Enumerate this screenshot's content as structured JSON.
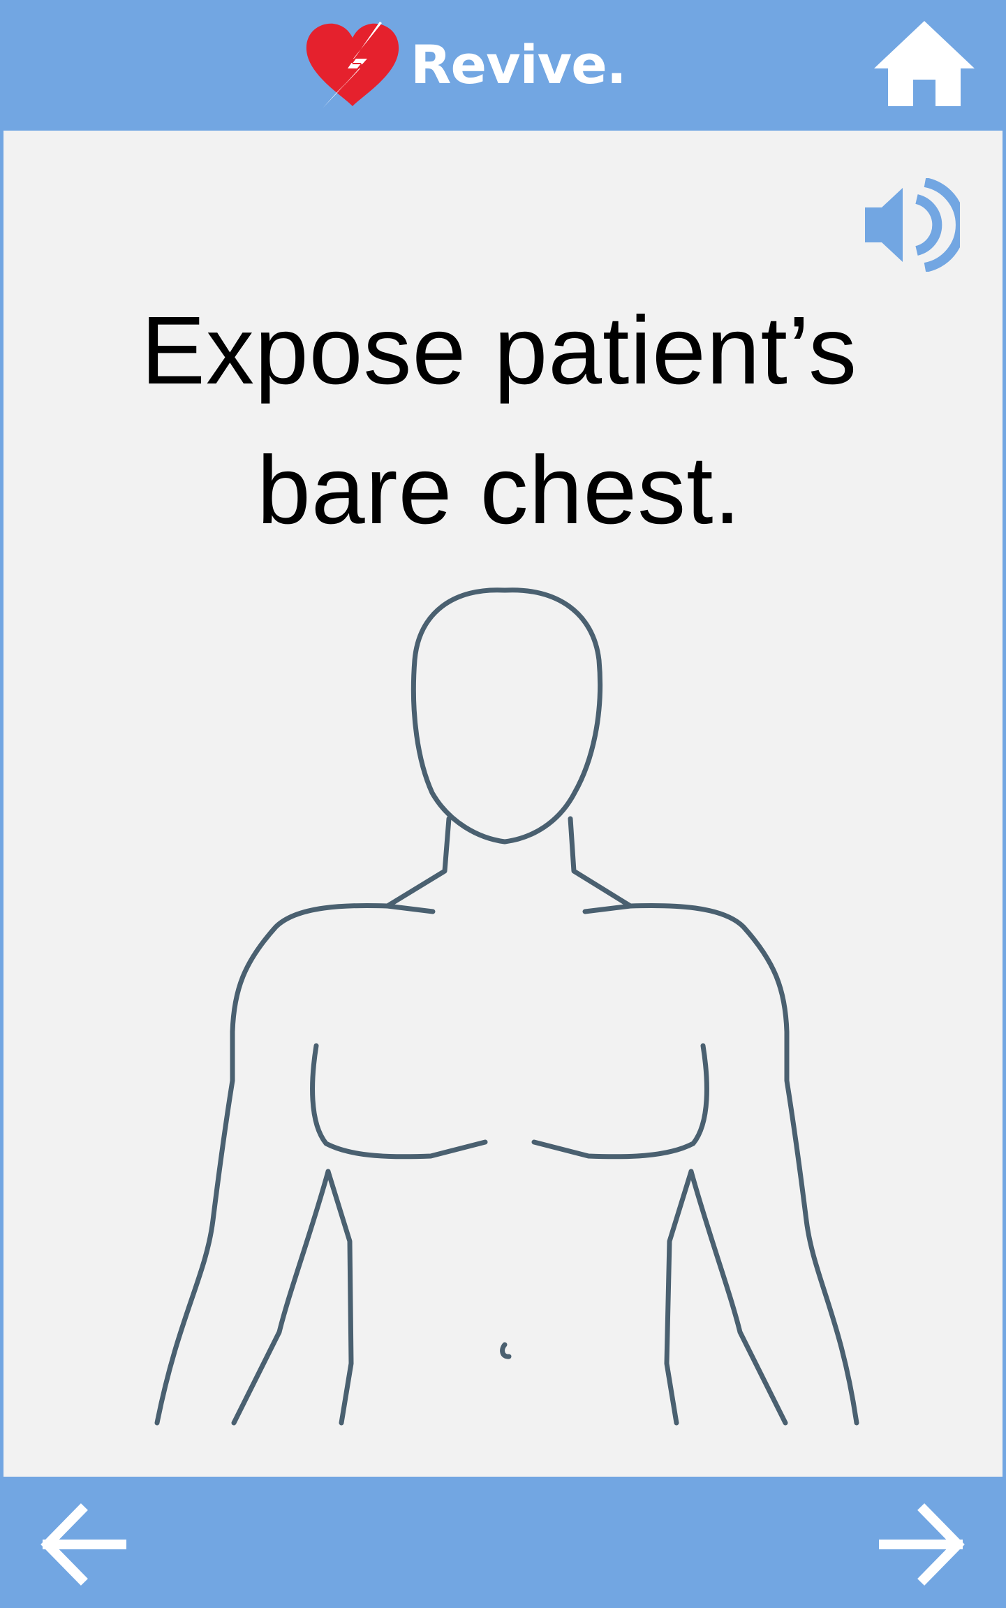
{
  "header": {
    "app_name": "Revive.",
    "logo_icon": "heart-lightning-icon",
    "home_icon": "home-icon"
  },
  "main": {
    "instruction": "Expose patient’s bare chest.",
    "audio_icon": "speaker-icon",
    "illustration": "bare-chest-torso-illustration"
  },
  "footer": {
    "back_icon": "arrow-left-icon",
    "next_icon": "arrow-right-icon"
  },
  "colors": {
    "bar": "#72a6e2",
    "content_bg": "#f2f2f2",
    "heart": "#e5212d",
    "outline": "#4a6070",
    "speaker": "#72a6e2",
    "icon_white": "#ffffff"
  }
}
